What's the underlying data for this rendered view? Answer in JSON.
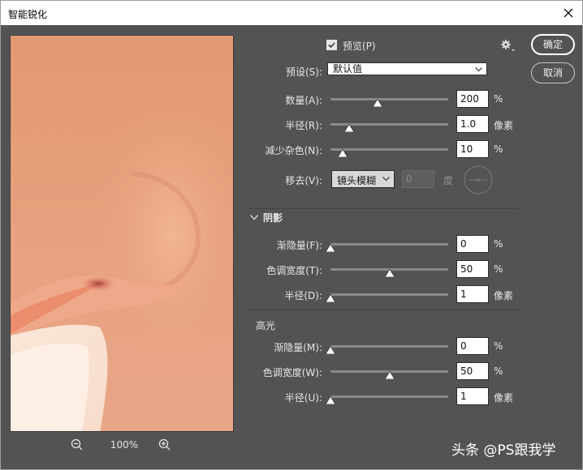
{
  "window": {
    "title": "智能锐化"
  },
  "preview_toggle": {
    "label": "预览(P)",
    "checked": true
  },
  "buttons": {
    "ok": "确定",
    "cancel": "取消"
  },
  "preset": {
    "label": "预设(S):",
    "value": "默认值"
  },
  "sharpen": {
    "amount": {
      "label": "数量(A):",
      "value": "200",
      "unit": "%",
      "level": 0.4
    },
    "radius": {
      "label": "半径(R):",
      "value": "1.0",
      "unit": "像素",
      "level": 0.16
    },
    "noise": {
      "label": "减少杂色(N):",
      "value": "10",
      "unit": "%",
      "level": 0.1
    }
  },
  "remove": {
    "label": "移去(V):",
    "value": "镜头模糊",
    "angle_value": "0",
    "angle_unit": "度"
  },
  "shadows": {
    "header": "阴影",
    "fade": {
      "label": "渐隐量(F):",
      "value": "0",
      "unit": "%",
      "level": 0.0
    },
    "tonal": {
      "label": "色调宽度(T):",
      "value": "50",
      "unit": "%",
      "level": 0.5
    },
    "radius": {
      "label": "半径(D):",
      "value": "1",
      "unit": "像素",
      "level": 0.0
    }
  },
  "highlights": {
    "header": "高光",
    "fade": {
      "label": "渐隐量(M):",
      "value": "0",
      "unit": "%",
      "level": 0.0
    },
    "tonal": {
      "label": "色调宽度(W):",
      "value": "50",
      "unit": "%",
      "level": 0.5
    },
    "radius": {
      "label": "半径(U):",
      "value": "1",
      "unit": "像素",
      "level": 0.0
    }
  },
  "zoom": {
    "value": "100%"
  },
  "watermark": "头条 @PS跟我学",
  "colors": {
    "panel": "#535353",
    "skin": "#e2a07e"
  }
}
